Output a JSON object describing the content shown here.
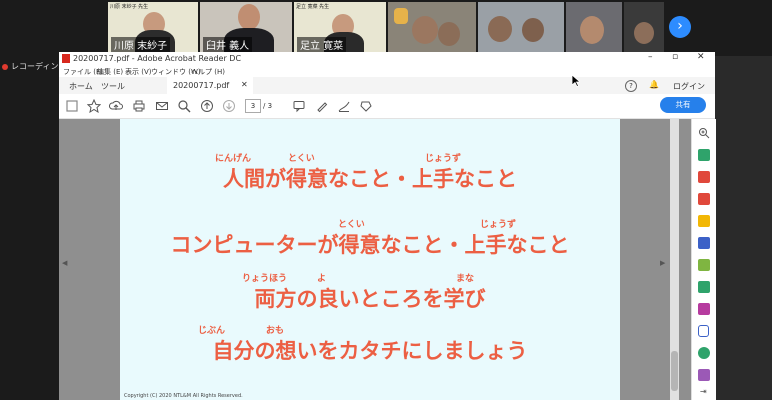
{
  "participants": [
    {
      "name": "川原 末紗子",
      "tile_bg": "#e8e6d2",
      "label_card": "川原 末紗子 先生"
    },
    {
      "name": "臼井 義人",
      "tile_bg": "#c9c4bb"
    },
    {
      "name": "足立 寛菜",
      "tile_bg": "#e8e6d2",
      "label_card": "足立 寛菜 先生"
    },
    {
      "name": "",
      "tile_bg": "#8a8478"
    },
    {
      "name": "",
      "tile_bg": "#9aa0a6"
    },
    {
      "name": "",
      "tile_bg": "#6b6b70"
    },
    {
      "name": "",
      "tile_bg": "#3a3a3a"
    }
  ],
  "zoom": {
    "recording_label": "レコーディングし",
    "next_icon": "chevron-right-icon"
  },
  "acrobat": {
    "window_title": "20200717.pdf - Adobe Acrobat Reader DC",
    "menus": [
      "ファイル (F)",
      "編集 (E)",
      "表示 (V)",
      "ウィンドウ (W)",
      "ヘルプ (H)"
    ],
    "tabs": {
      "home": "ホーム",
      "tools": "ツール",
      "document": "20200717.pdf"
    },
    "login": "ログイン",
    "share": "共有",
    "page_current": "3",
    "page_total": "/ 3",
    "accent": "#2680eb"
  },
  "slide": {
    "lines": [
      {
        "text": "人間が得意なこと・上手なこと",
        "furigana": [
          "にんげん",
          "とくい",
          "じょうず"
        ]
      },
      {
        "text": "コンピューターが得意なこと・上手なこと",
        "furigana": [
          "とくい",
          "じょうず"
        ]
      },
      {
        "text": "両方の良いところを学び",
        "furigana": [
          "りょうほう",
          "よ",
          "まな"
        ]
      },
      {
        "text": "自分の想いをカタチにしましょう",
        "furigana": [
          "じぶん",
          "おも"
        ]
      }
    ],
    "copyright": "Copyright (C) 2020 NTL&M All Rights Reserved.",
    "text_color": "#ec5f43",
    "bg_color": "#e9fafd"
  }
}
